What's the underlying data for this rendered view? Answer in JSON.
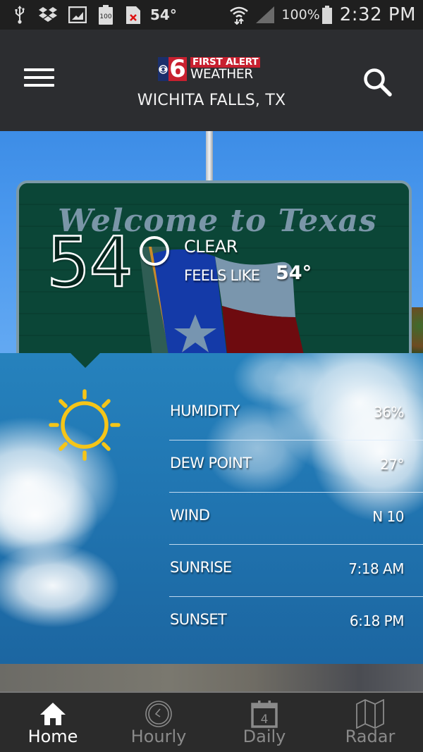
{
  "status_bar": {
    "notification_icons": [
      "usb-icon",
      "dropbox-icon",
      "image-icon",
      "battery-100-notification-icon",
      "sd-card-error-icon"
    ],
    "temp_widget": "54°",
    "battery_percent": "100%",
    "time": "2:32 PM",
    "battery_widget_label": "100"
  },
  "header": {
    "logo": {
      "channel": "6",
      "line1": "FIRST ALERT",
      "line2": "WEATHER"
    },
    "location": "WICHITA FALLS, TX",
    "colors": {
      "background": "#2c2d30",
      "logo_red": "#c8202f",
      "logo_blue": "#1b2f6b"
    }
  },
  "current": {
    "temperature": "54",
    "condition": "CLEAR",
    "feels_like_label": "FEELS LIKE",
    "feels_like_value": "54°",
    "background_sign_text": "Welcome to Texas",
    "icon": "sun-icon"
  },
  "details": {
    "rows": [
      {
        "label": "HUMIDITY",
        "value": "36%"
      },
      {
        "label": "DEW POINT",
        "value": "27°"
      },
      {
        "label": "WIND",
        "value": "N 10"
      },
      {
        "label": "SUNRISE",
        "value": "7:18 AM"
      },
      {
        "label": "SUNSET",
        "value": "6:18 PM"
      }
    ],
    "colors": {
      "sun": "#f5c518",
      "panel": "#2177b3"
    }
  },
  "nav": {
    "items": [
      {
        "label": "Home",
        "icon": "home-icon",
        "active": true
      },
      {
        "label": "Hourly",
        "icon": "clock-icon",
        "active": false
      },
      {
        "label": "Daily",
        "icon": "calendar-icon",
        "active": false,
        "badge": "4"
      },
      {
        "label": "Radar",
        "icon": "map-icon",
        "active": false
      }
    ]
  }
}
